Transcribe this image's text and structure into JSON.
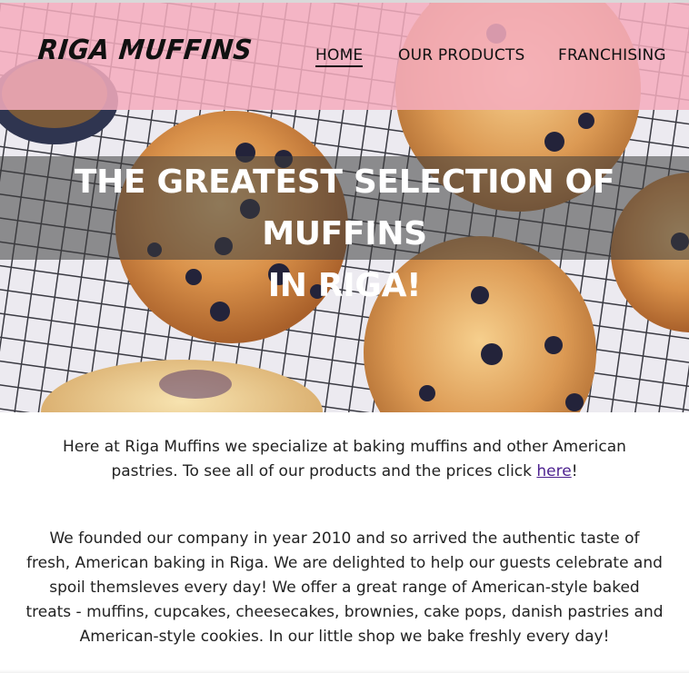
{
  "brand": {
    "logo_text": "RIGA MUFFINS"
  },
  "nav": {
    "items": [
      {
        "label": "HOME",
        "active": true
      },
      {
        "label": "OUR PRODUCTS",
        "active": false
      },
      {
        "label": "FRANCHISING",
        "active": false
      }
    ]
  },
  "hero": {
    "headline_line1": "THE GREATEST SELECTION OF MUFFINS",
    "headline_line2": "IN RIGA!",
    "image_subject": "blueberry muffins on a cooling rack"
  },
  "intro": {
    "text_before_link": "Here at Riga Muffins we specialize at baking muffins and other American pastries. To see all of our products and the prices click ",
    "link_text": "here",
    "text_after_link": "!"
  },
  "about": {
    "text": "We founded our company in year 2010 and so arrived the authentic taste of fresh, American baking in Riga. We are delighted to help our guests celebrate and spoil themsleves every day! We offer a great range of American-style baked treats - muffins, cupcakes, cheesecakes, brownies, cake pops, danish pastries and American-style cookies. In our little shop we bake freshly every day!"
  },
  "colors": {
    "header_bg": "#f5acbe",
    "headline_band": "#3c3c3c",
    "link": "#4b1f8f",
    "text": "#222222"
  }
}
